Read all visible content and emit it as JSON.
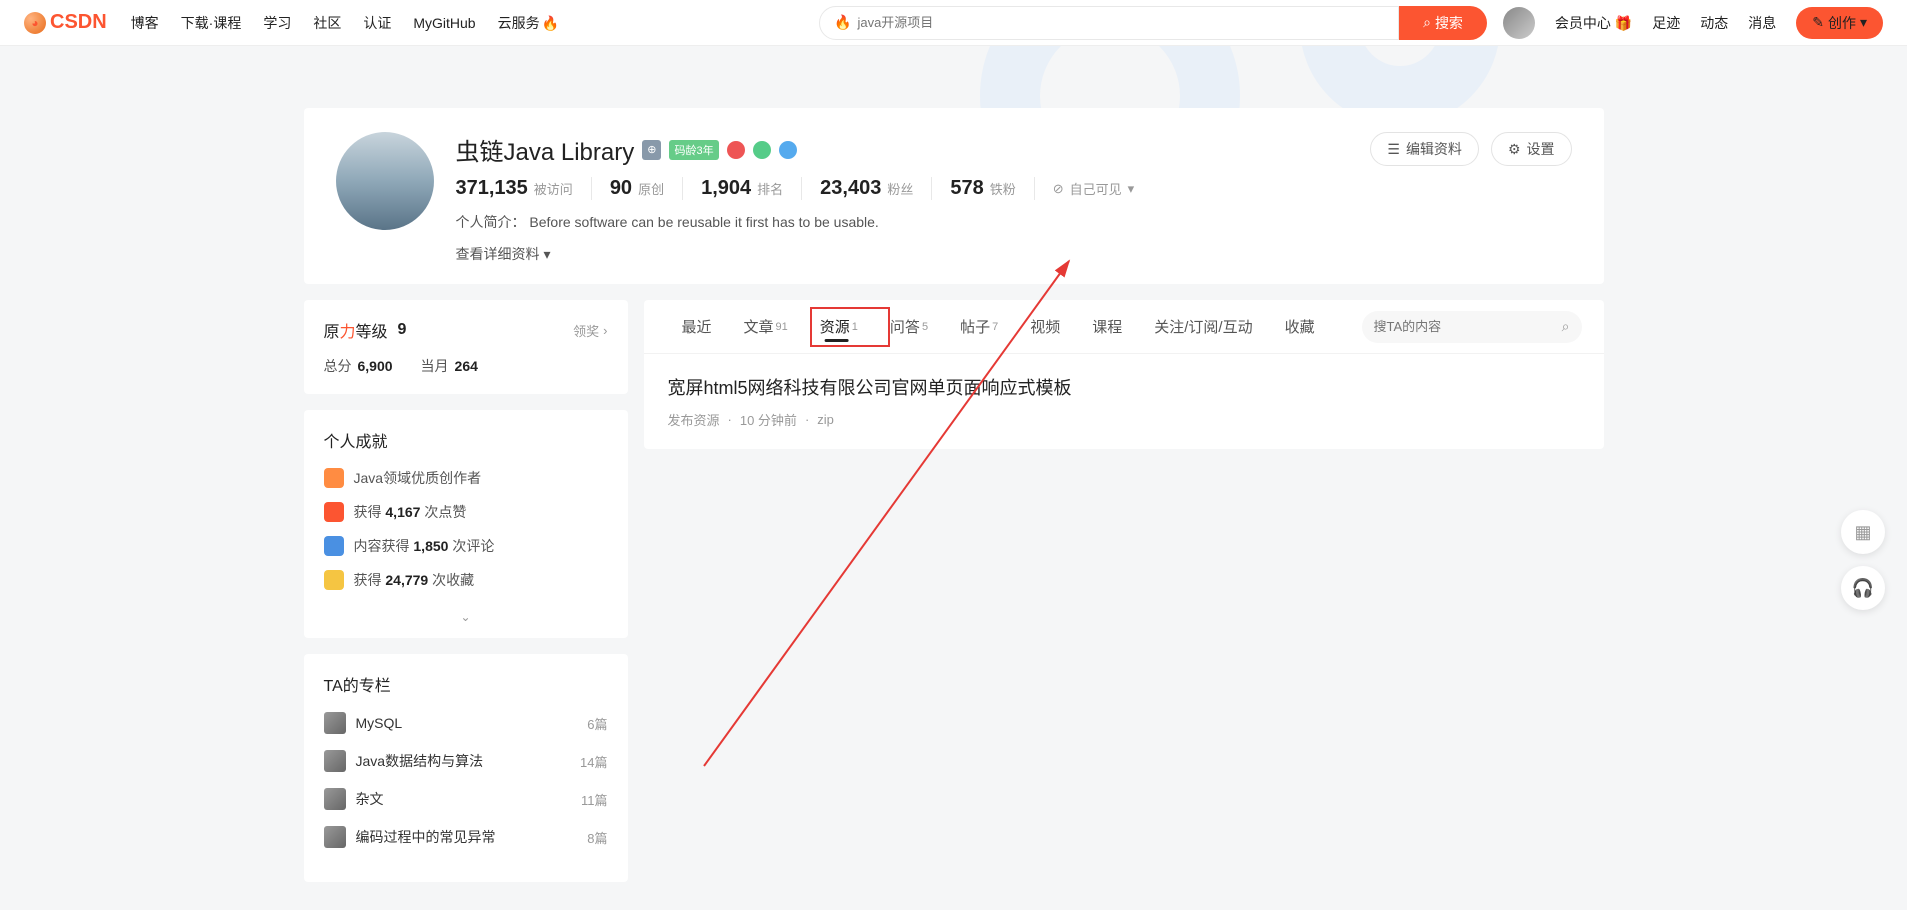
{
  "topnav": {
    "logo": "CSDN",
    "links": [
      "博客",
      "下载·课程",
      "学习",
      "社区",
      "认证",
      "MyGitHub",
      "云服务"
    ],
    "search_placeholder": "java开源项目",
    "search_btn": "搜索",
    "right": [
      "会员中心",
      "足迹",
      "动态",
      "消息"
    ],
    "create": "创作"
  },
  "profile": {
    "name": "虫链Java Library",
    "badge_auth": "⊕",
    "badge_age": "码龄3年",
    "stats": [
      {
        "num": "371,135",
        "lbl": "被访问"
      },
      {
        "num": "90",
        "lbl": "原创"
      },
      {
        "num": "1,904",
        "lbl": "排名"
      },
      {
        "num": "23,403",
        "lbl": "粉丝"
      },
      {
        "num": "578",
        "lbl": "铁粉"
      }
    ],
    "visibility": "自己可见",
    "bio_lbl": "个人简介：",
    "bio": "Before software can be reusable it first has to be usable.",
    "detail": "查看详细资料",
    "edit": "编辑资料",
    "settings": "设置"
  },
  "force": {
    "title_a": "原",
    "title_b": "力",
    "title_c": "等级",
    "level": "9",
    "award": "领奖",
    "total_lbl": "总分",
    "total": "6,900",
    "month_lbl": "当月",
    "month": "264"
  },
  "ach": {
    "title": "个人成就",
    "items": [
      {
        "cls": "ai-o",
        "text_a": "Java领域优质创作者"
      },
      {
        "cls": "ai-r",
        "text_a": "获得 ",
        "b": "4,167",
        "text_b": " 次点赞"
      },
      {
        "cls": "ai-b",
        "text_a": "内容获得 ",
        "b": "1,850",
        "text_b": " 次评论"
      },
      {
        "cls": "ai-y",
        "text_a": "获得 ",
        "b": "24,779",
        "text_b": " 次收藏"
      }
    ]
  },
  "columns": {
    "title": "TA的专栏",
    "items": [
      {
        "name": "MySQL",
        "cnt": "6篇"
      },
      {
        "name": "Java数据结构与算法",
        "cnt": "14篇"
      },
      {
        "name": "杂文",
        "cnt": "11篇"
      },
      {
        "name": "编码过程中的常见异常",
        "cnt": "8篇"
      }
    ]
  },
  "tabs": {
    "items": [
      {
        "lbl": "最近",
        "sup": ""
      },
      {
        "lbl": "文章",
        "sup": "91"
      },
      {
        "lbl": "资源",
        "sup": "1",
        "active": true
      },
      {
        "lbl": "问答",
        "sup": "5"
      },
      {
        "lbl": "帖子",
        "sup": "7"
      },
      {
        "lbl": "视频",
        "sup": ""
      },
      {
        "lbl": "课程",
        "sup": ""
      },
      {
        "lbl": "关注/订阅/互动",
        "sup": ""
      },
      {
        "lbl": "收藏",
        "sup": ""
      }
    ],
    "search_placeholder": "搜TA的内容"
  },
  "resource": {
    "title": "宽屏html5网络科技有限公司官网单页面响应式模板",
    "meta_a": "发布资源",
    "meta_b": "10 分钟前",
    "meta_c": "zip"
  }
}
